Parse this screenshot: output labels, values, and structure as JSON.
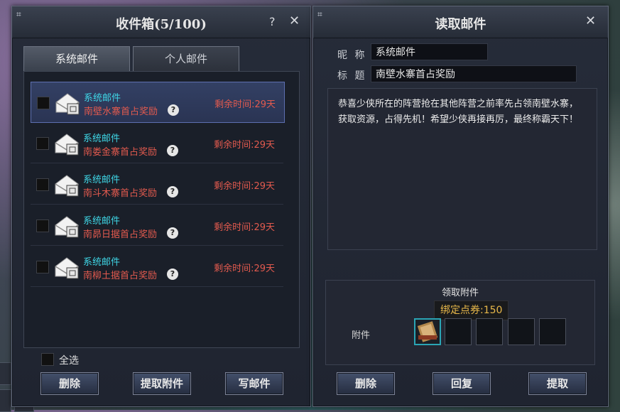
{
  "inbox": {
    "title": "收件箱(5/100)",
    "help": "?",
    "close": "✕",
    "tabs": [
      {
        "label": "系统邮件",
        "active": true
      },
      {
        "label": "个人邮件",
        "active": false
      }
    ],
    "mails": [
      {
        "sender": "系统邮件",
        "subject": "南壁水寨首占奖励",
        "remaining": "剩余时间:29天",
        "selected": true
      },
      {
        "sender": "系统邮件",
        "subject": "南娄金寨首占奖励",
        "remaining": "剩余时间:29天",
        "selected": false
      },
      {
        "sender": "系统邮件",
        "subject": "南斗木寨首占奖励",
        "remaining": "剩余时间:29天",
        "selected": false
      },
      {
        "sender": "系统邮件",
        "subject": "南昴日据首占奖励",
        "remaining": "剩余时间:29天",
        "selected": false
      },
      {
        "sender": "系统邮件",
        "subject": "南柳土据首占奖励",
        "remaining": "剩余时间:29天",
        "selected": false
      }
    ],
    "select_all": "全选",
    "buttons": {
      "delete": "删除",
      "extract_attachments": "提取附件",
      "write_mail": "写邮件"
    }
  },
  "reader": {
    "title": "读取邮件",
    "close": "✕",
    "nickname_label": "昵 称",
    "nickname_value": "系统邮件",
    "subject_label": "标 题",
    "subject_value": "南壁水寨首占奖励",
    "body": "恭喜少侠所在的阵营抢在其他阵营之前率先占领南壁水寨，获取资源，占得先机！希望少侠再接再厉，最终称霸天下！",
    "attachment_title": "领取附件",
    "attachment_label": "附件",
    "tooltip": "绑定点券:150",
    "buttons": {
      "delete": "删除",
      "reply": "回复",
      "extract": "提取"
    }
  },
  "colors": {
    "sender": "#3fd6e6",
    "subject": "#e25a4e",
    "tooltip": "#e8b84a"
  }
}
